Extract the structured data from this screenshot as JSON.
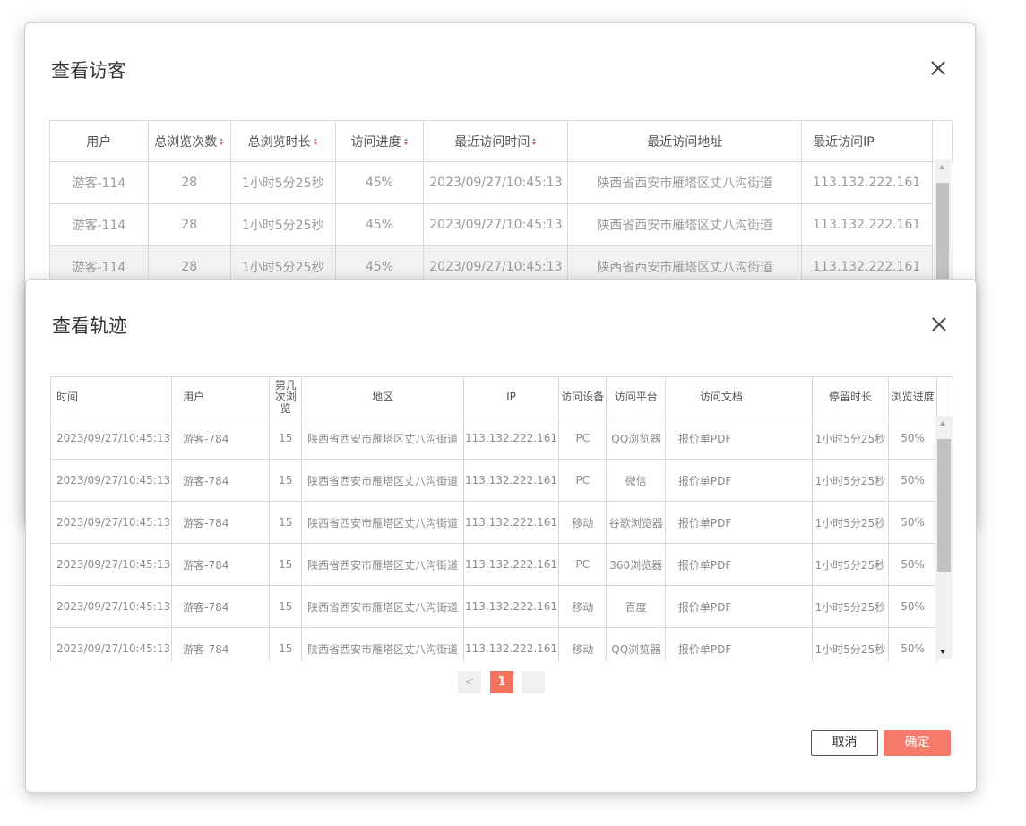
{
  "visitor_dialog": {
    "title": "查看访客",
    "columns": [
      "用户",
      "总浏览次数",
      "总浏览时长",
      "访问进度",
      "最近访问时间",
      "最近访问地址",
      "最近访问IP"
    ],
    "rows": [
      [
        "游客-114",
        "28",
        "1小时5分25秒",
        "45%",
        "2023/09/27/10:45:13",
        "陕西省西安市雁塔区丈八沟街道",
        "113.132.222.161"
      ],
      [
        "游客-114",
        "28",
        "1小时5分25秒",
        "45%",
        "2023/09/27/10:45:13",
        "陕西省西安市雁塔区丈八沟街道",
        "113.132.222.161"
      ],
      [
        "游客-114",
        "28",
        "1小时5分25秒",
        "45%",
        "2023/09/27/10:45:13",
        "陕西省西安市雁塔区丈八沟街道",
        "113.132.222.161"
      ]
    ]
  },
  "track_dialog": {
    "title": "查看轨迹",
    "columns": [
      "时间",
      "用户",
      "第几次浏览",
      "地区",
      "IP",
      "访问设备",
      "访问平台",
      "访问文档",
      "停留时长",
      "浏览进度"
    ],
    "rows": [
      [
        "2023/09/27/10:45:13",
        "游客-784",
        "15",
        "陕西省西安市雁塔区丈八沟街道",
        "113.132.222.161",
        "PC",
        "QQ浏览器",
        "报价单PDF",
        "1小时5分25秒",
        "50%"
      ],
      [
        "2023/09/27/10:45:13",
        "游客-784",
        "15",
        "陕西省西安市雁塔区丈八沟街道",
        "113.132.222.161",
        "PC",
        "微信",
        "报价单PDF",
        "1小时5分25秒",
        "50%"
      ],
      [
        "2023/09/27/10:45:13",
        "游客-784",
        "15",
        "陕西省西安市雁塔区丈八沟街道",
        "113.132.222.161",
        "移动",
        "谷歌浏览器",
        "报价单PDF",
        "1小时5分25秒",
        "50%"
      ],
      [
        "2023/09/27/10:45:13",
        "游客-784",
        "15",
        "陕西省西安市雁塔区丈八沟街道",
        "113.132.222.161",
        "PC",
        "360浏览器",
        "报价单PDF",
        "1小时5分25秒",
        "50%"
      ],
      [
        "2023/09/27/10:45:13",
        "游客-784",
        "15",
        "陕西省西安市雁塔区丈八沟街道",
        "113.132.222.161",
        "移动",
        "百度",
        "报价单PDF",
        "1小时5分25秒",
        "50%"
      ],
      [
        "2023/09/27/10:45:13",
        "游客-784",
        "15",
        "陕西省西安市雁塔区丈八沟街道",
        "113.132.222.161",
        "移动",
        "QQ浏览器",
        "报价单PDF",
        "1小时5分25秒",
        "50%"
      ]
    ],
    "pagination": {
      "prev": "<",
      "current": "1"
    },
    "cancel_label": "取消",
    "confirm_label": "确定"
  },
  "colors": {
    "accent": "#f4735f",
    "sort_active": "#e0574a"
  },
  "icons": {
    "close": "close-icon",
    "sort": "sort-icon"
  }
}
